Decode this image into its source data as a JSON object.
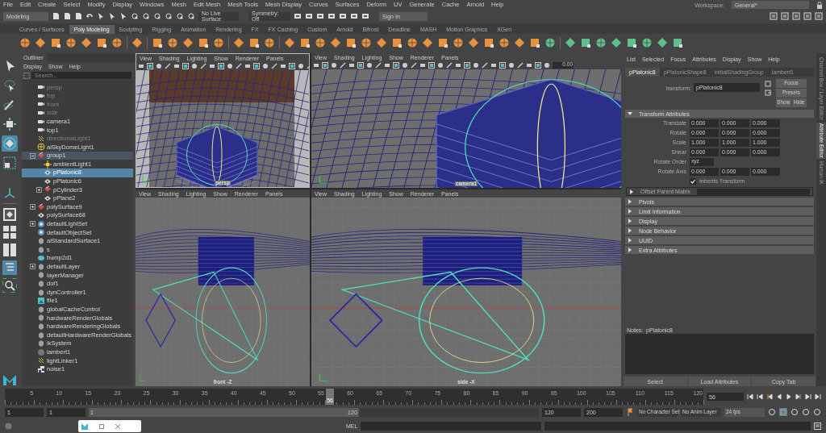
{
  "menu_bar": {
    "items": [
      "File",
      "Edit",
      "Create",
      "Select",
      "Modify",
      "Display",
      "Windows",
      "Mesh",
      "Edit Mesh",
      "Mesh Tools",
      "Mesh Display",
      "Curves",
      "Surfaces",
      "Deform",
      "UV",
      "Generate",
      "Cache",
      "Arnold",
      "Help"
    ],
    "workspace_label": "Workspace:",
    "workspace": "General*"
  },
  "status_line": {
    "menu_set": "Modeling",
    "live_surface": "No Live Surface",
    "symmetry": "Symmetry: Off",
    "sign_in": "Sign In"
  },
  "shelf": {
    "tabs": [
      {
        "label": "Curves / Surfaces",
        "selected": false
      },
      {
        "label": "Poly Modeling",
        "selected": true
      },
      {
        "label": "Sculpting",
        "selected": false
      },
      {
        "label": "Rigging",
        "selected": false
      },
      {
        "label": "Animation",
        "selected": false
      },
      {
        "label": "Rendering",
        "selected": false
      },
      {
        "label": "FX",
        "selected": false
      },
      {
        "label": "FX Caching",
        "selected": false
      },
      {
        "label": "Custom",
        "selected": false
      },
      {
        "label": "Arnold",
        "selected": false
      },
      {
        "label": "Bifrost",
        "selected": false
      },
      {
        "label": "Deadline",
        "selected": false
      },
      {
        "label": "MASH",
        "selected": false
      },
      {
        "label": "Motion Graphics",
        "selected": false
      },
      {
        "label": "XGen",
        "selected": false
      }
    ]
  },
  "toolbox": [
    {
      "kind": "select",
      "selected": false
    },
    {
      "kind": "lasso",
      "selected": false
    },
    {
      "kind": "paint",
      "selected": false
    },
    {
      "kind": "move",
      "selected": false
    },
    {
      "kind": "rotate",
      "selected": true
    },
    {
      "kind": "scale",
      "selected": false
    }
  ],
  "outliner": {
    "title": "Outliner",
    "menus": [
      "Display",
      "Show",
      "Help"
    ],
    "search_placeholder": "Search...",
    "items": [
      {
        "label": "persp",
        "kind": "camera",
        "hidden": true
      },
      {
        "label": "top",
        "kind": "camera",
        "hidden": true
      },
      {
        "label": "front",
        "kind": "camera",
        "hidden": true
      },
      {
        "label": "side",
        "kind": "camera",
        "hidden": true
      },
      {
        "label": "camera1",
        "kind": "camera",
        "hidden": false
      },
      {
        "label": "top1",
        "kind": "camera",
        "hidden": false
      },
      {
        "label": "directionalLight1",
        "kind": "light",
        "hidden": true
      },
      {
        "label": "aiSkyDomeLight1",
        "kind": "dome",
        "hidden": false
      },
      {
        "label": "group1",
        "kind": "group",
        "hidden": false,
        "expanded": true,
        "children": [
          {
            "label": "ambientLight1",
            "kind": "sun",
            "hidden": false,
            "selected": false
          },
          {
            "label": "pPlatonic8",
            "kind": "mesh",
            "hidden": false,
            "selected": true
          },
          {
            "label": "pPlatonic6",
            "kind": "mesh",
            "hidden": false,
            "selected": false
          },
          {
            "label": "pCylinder3",
            "kind": "group",
            "hidden": false,
            "selected": false,
            "expanded": false
          },
          {
            "label": "pPlane2",
            "kind": "mesh",
            "hidden": false,
            "selected": false
          }
        ]
      },
      {
        "label": "polySurface9",
        "kind": "group",
        "hidden": false,
        "expanded": false
      },
      {
        "label": "polySurface68",
        "kind": "mesh",
        "hidden": false
      },
      {
        "label": "defaultLightSet",
        "kind": "set",
        "hidden": false,
        "expanded": false
      },
      {
        "label": "defaultObjectSet",
        "kind": "set",
        "hidden": false
      },
      {
        "label": "aiStandardSurface1",
        "kind": "node",
        "hidden": false
      },
      {
        "label": "s",
        "kind": "node",
        "hidden": false
      },
      {
        "label": "bump2d1",
        "kind": "bump",
        "hidden": false
      },
      {
        "label": "defaultLayer",
        "kind": "node",
        "hidden": false,
        "expanded": false
      },
      {
        "label": "layerManager",
        "kind": "node",
        "hidden": false
      },
      {
        "label": "dof1",
        "kind": "node",
        "hidden": false
      },
      {
        "label": "dynController1",
        "kind": "node",
        "hidden": false
      },
      {
        "label": "file1",
        "kind": "file",
        "hidden": false
      },
      {
        "label": "globalCacheControl",
        "kind": "node",
        "hidden": false
      },
      {
        "label": "hardwareRenderGlobals",
        "kind": "node",
        "hidden": false
      },
      {
        "label": "hardwareRenderingGlobals",
        "kind": "node",
        "hidden": false
      },
      {
        "label": "defaultHardwareRenderGlobals",
        "kind": "node",
        "hidden": false
      },
      {
        "label": "ikSystem",
        "kind": "node",
        "hidden": false
      },
      {
        "label": "lambert1",
        "kind": "sphere",
        "hidden": false
      },
      {
        "label": "lightLinker1",
        "kind": "light",
        "hidden": false
      },
      {
        "label": "noise1",
        "kind": "noise",
        "hidden": false
      }
    ]
  },
  "viewports": [
    {
      "menus": [
        "View",
        "Shading",
        "Lighting",
        "Show",
        "Renderer",
        "Panels"
      ],
      "camera": "persp",
      "kind": "persp"
    },
    {
      "menus": [
        "View",
        "Shading",
        "Lighting",
        "Show",
        "Renderer",
        "Panels"
      ],
      "camera": "camera1",
      "kind": "closeup",
      "field": "0.00"
    },
    {
      "menus": [
        "View",
        "Shading",
        "Lighting",
        "Show",
        "Renderer",
        "Panels"
      ],
      "camera": "front -Z",
      "kind": "ortho"
    },
    {
      "menus": [
        "View",
        "Shading",
        "Lighting",
        "Show",
        "Renderer",
        "Panels"
      ],
      "camera": "side -X",
      "kind": "ortho"
    }
  ],
  "attribute_editor": {
    "menus": [
      "List",
      "Selected",
      "Focus",
      "Attributes",
      "Display",
      "Show",
      "Help"
    ],
    "tabs": [
      {
        "label": "pPlatonic8",
        "selected": true
      },
      {
        "label": "pPlatonicShape8",
        "selected": false
      },
      {
        "label": "initialShadingGroup",
        "selected": false
      },
      {
        "label": "lambert1",
        "selected": false
      }
    ],
    "transform_label": "transform:",
    "transform": "pPlatonic8",
    "buttons": [
      "Focus",
      "Presets",
      "Show",
      "Hide"
    ],
    "sections": [
      {
        "title": "Transform Attributes",
        "expanded": true,
        "rows": [
          {
            "label": "Translate",
            "kind": "vector",
            "values": [
              "0.000",
              "0.000",
              "0.000"
            ]
          },
          {
            "label": "Rotate",
            "kind": "vector",
            "values": [
              "0.000",
              "0.000",
              "0.000"
            ]
          },
          {
            "label": "Scale",
            "kind": "vector",
            "values": [
              "1.000",
              "1.000",
              "1.000"
            ]
          },
          {
            "label": "Shear",
            "kind": "vector",
            "values": [
              "0.000",
              "0.000",
              "0.000"
            ]
          },
          {
            "label": "Rotate Order",
            "kind": "dropdown",
            "value": "xyz"
          },
          {
            "label": "Rotate Axis",
            "kind": "vector",
            "values": [
              "0.000",
              "0.000",
              "0.000"
            ]
          },
          {
            "label": "Inherits Transform",
            "kind": "checkbox",
            "checked": true
          }
        ]
      },
      {
        "title": "Offset Parent Matrix",
        "expanded": false,
        "kind": "field"
      },
      {
        "title": "Pivots",
        "expanded": false
      },
      {
        "title": "Limit Information",
        "expanded": false
      },
      {
        "title": "Display",
        "expanded": false
      },
      {
        "title": "Node Behavior",
        "expanded": false
      },
      {
        "title": "UUID",
        "expanded": false
      },
      {
        "title": "Extra Attributes",
        "expanded": false
      }
    ],
    "notes": "Notes:  pPlatonic8",
    "bottom_buttons": [
      "Select",
      "Load Attributes",
      "Copy Tab"
    ],
    "side_tabs": [
      {
        "label": "Channel Box / Layer Editor",
        "selected": false
      },
      {
        "label": "Attribute Editor",
        "selected": true
      },
      {
        "label": "Human IK",
        "selected": false
      }
    ]
  },
  "time_slider": {
    "ticks": [
      "5",
      "10",
      "15",
      "20",
      "25",
      "30",
      "35",
      "40",
      "45",
      "50",
      "55",
      "60",
      "65",
      "70",
      "75",
      "80",
      "85",
      "90",
      "95",
      "100",
      "105",
      "110",
      "115",
      "120"
    ],
    "current": "56",
    "level": 0.462,
    "current_field": "56"
  },
  "range_slider": {
    "start": "1",
    "range_start_field": "1",
    "bar_start": "1",
    "bar_end": "120",
    "level": 0.6,
    "range_end": "120",
    "end": "200",
    "character_set": "No Character Set",
    "anim_layer": "No Anim Layer",
    "fps": "24 fps"
  },
  "command_line": {
    "language": "MEL"
  }
}
